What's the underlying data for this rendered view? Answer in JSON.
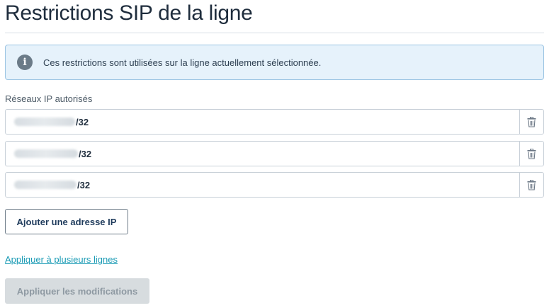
{
  "page": {
    "title": "Restrictions SIP de la ligne"
  },
  "info_message": {
    "icon": "info-icon",
    "text": "Ces restrictions sont utilisées sur la ligne actuellement sélectionnée."
  },
  "ip_networks": {
    "label": "Réseaux IP autorisés",
    "items": [
      {
        "address_hidden": true,
        "suffix": "/32",
        "delete_icon": "trash-icon"
      },
      {
        "address_hidden": true,
        "suffix": "/32",
        "delete_icon": "trash-icon"
      },
      {
        "address_hidden": true,
        "suffix": "/32",
        "delete_icon": "trash-icon"
      }
    ]
  },
  "actions": {
    "add_ip_label": "Ajouter une adresse IP",
    "apply_multiple_label": "Appliquer à plusieurs lignes",
    "apply_changes_label": "Appliquer les modifications",
    "apply_changes_disabled": true
  },
  "colors": {
    "title": "#1f2d3d",
    "info_background": "#e6f2fb",
    "info_border": "#9bc4e3",
    "link": "#1a9bb5",
    "disabled_button": "#d7dcdf"
  }
}
